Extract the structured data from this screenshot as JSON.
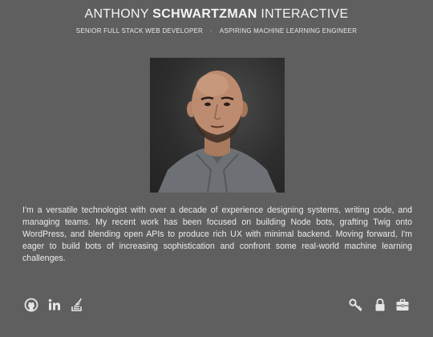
{
  "header": {
    "title_pre": "ANTHONY ",
    "title_bold": "SCHWARTZMAN",
    "title_post": " INTERACTIVE",
    "role_1": "SENIOR FULL STACK WEB DEVELOPER",
    "separator": "·",
    "role_2": "ASPIRING MACHINE LEARNING ENGINEER"
  },
  "bio": "I'm a versatile technologist with over a decade of experience designing systems, writing code, and managing teams. My recent work has been focused on building Node bots, grafting Twig onto WordPress, and blending open APIs to produce rich UX with minimal backend. Moving forward, I'm eager to build bots of increasing sophistication and confront some real-world machine learning challenges.",
  "social_icons": [
    "github-icon",
    "linkedin-icon",
    "stackoverflow-icon"
  ],
  "utility_icons": [
    "key-icon",
    "lock-icon",
    "briefcase-icon"
  ],
  "colors": {
    "background": "#5f5f5f",
    "text": "#f0f0f0",
    "icon": "#e6e6e6"
  }
}
